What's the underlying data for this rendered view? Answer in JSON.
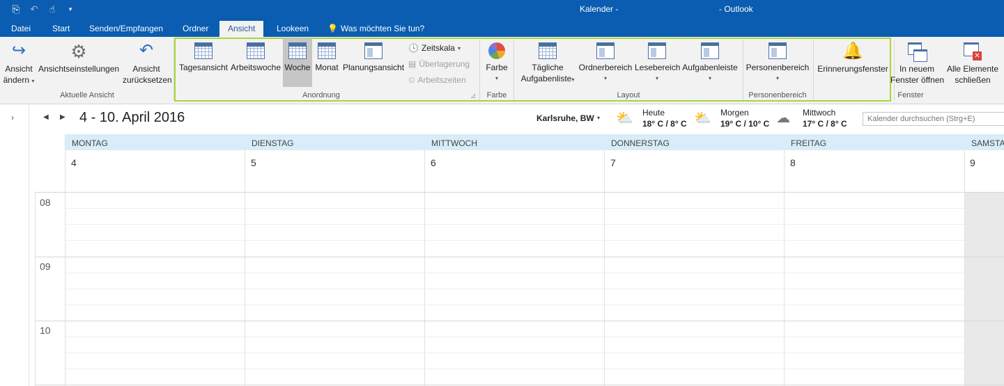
{
  "titlebar": {
    "app_title": "Kalender -",
    "suffix": "- Outlook",
    "qat_icons": [
      "send-receive-icon",
      "undo-icon",
      "touch-mode-icon",
      "customize-qat-icon"
    ]
  },
  "tabs": [
    {
      "label": "Datei"
    },
    {
      "label": "Start"
    },
    {
      "label": "Senden/Empfangen"
    },
    {
      "label": "Ordner"
    },
    {
      "label": "Ansicht",
      "active": true
    },
    {
      "label": "Lookeen"
    },
    {
      "label": "Was möchten Sie tun?"
    }
  ],
  "ribbon": {
    "aktuelle_ansicht": {
      "label": "Aktuelle Ansicht",
      "change_view": [
        "Ansicht",
        "ändern"
      ],
      "view_settings": "Ansichtseinstellungen",
      "reset_view": [
        "Ansicht",
        "zurücksetzen"
      ]
    },
    "anordnung": {
      "label": "Anordnung",
      "day": "Tagesansicht",
      "workweek": "Arbeitswoche",
      "week": "Woche",
      "month": "Monat",
      "schedule": "Planungsansicht",
      "timescale": "Zeitskala",
      "overlay": "Überlagerung",
      "worktime": "Arbeitszeiten"
    },
    "farbe": {
      "label": "Farbe",
      "color": "Farbe"
    },
    "layout": {
      "label": "Layout",
      "daily_tasks": [
        "Tägliche",
        "Aufgabenliste"
      ],
      "folder_pane": "Ordnerbereich",
      "reading_pane": "Lesebereich",
      "todo_bar": "Aufgabenleiste"
    },
    "personen": {
      "label": "Personenbereich",
      "people_pane": "Personenbereich"
    },
    "reminders": "Erinnerungsfenster",
    "fenster": {
      "label": "Fenster",
      "open_new": [
        "In neuem",
        "Fenster öffnen"
      ],
      "close_all": [
        "Alle Elemente",
        "schließen"
      ]
    }
  },
  "calendar": {
    "date_range": "4 - 10. April 2016",
    "location": "Karlsruhe, BW",
    "weather": [
      {
        "label": "Heute",
        "temp": "18° C / 8° C",
        "icon": "sun-cloud-icon"
      },
      {
        "label": "Morgen",
        "temp": "19° C / 10° C",
        "icon": "sun-cloud-icon"
      },
      {
        "label": "Mittwoch",
        "temp": "17° C / 8° C",
        "icon": "cloud-icon"
      }
    ],
    "search_placeholder": "Kalender durchsuchen (Strg+E)",
    "days": [
      {
        "name": "MONTAG",
        "num": "4"
      },
      {
        "name": "DIENSTAG",
        "num": "5"
      },
      {
        "name": "MITTWOCH",
        "num": "6"
      },
      {
        "name": "DONNERSTAG",
        "num": "7"
      },
      {
        "name": "FREITAG",
        "num": "8"
      },
      {
        "name": "SAMSTAG",
        "num": "9"
      }
    ],
    "hours": [
      "08",
      "09",
      "10"
    ]
  }
}
